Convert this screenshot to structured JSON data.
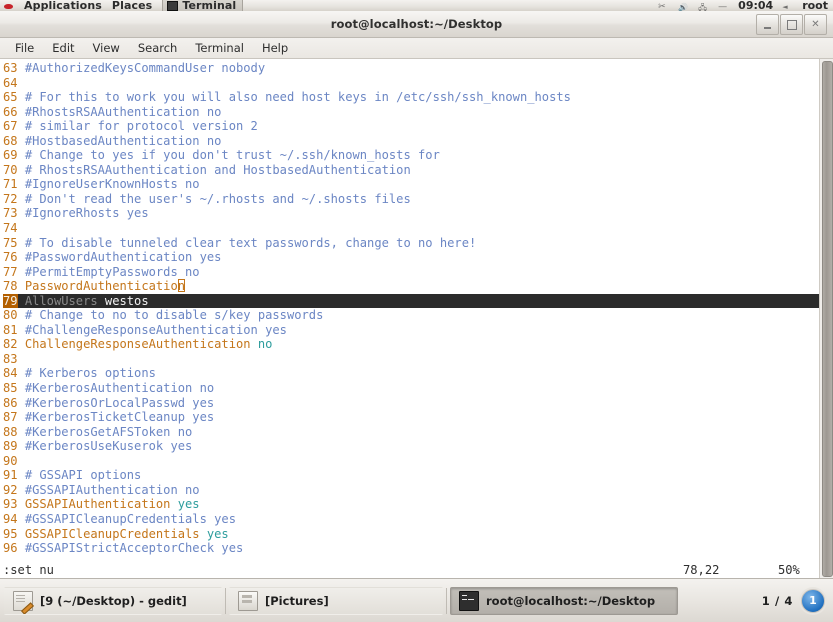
{
  "top_panel": {
    "menus": [
      "Applications",
      "Places"
    ],
    "window_button": "Terminal",
    "tray_icons": [
      "scissors-icon",
      "volume-icon",
      "network-icon",
      "power-icon"
    ],
    "clock": "09:04",
    "user": "root"
  },
  "window": {
    "title": "root@localhost:~/Desktop",
    "controls": {
      "minimize": "–",
      "maximize": "□",
      "close": "✕"
    },
    "menubar": [
      "File",
      "Edit",
      "View",
      "Search",
      "Terminal",
      "Help"
    ]
  },
  "terminal": {
    "lines": [
      {
        "n": "63",
        "segs": [
          {
            "t": "#AuthorizedKeysCommandUser nobody",
            "c": "cmt"
          }
        ]
      },
      {
        "n": "64",
        "segs": []
      },
      {
        "n": "65",
        "segs": [
          {
            "t": "# For this to work you will also need host keys in /etc/ssh/ssh_known_hosts",
            "c": "cmt"
          }
        ]
      },
      {
        "n": "66",
        "segs": [
          {
            "t": "#RhostsRSAAuthentication no",
            "c": "cmt"
          }
        ]
      },
      {
        "n": "67",
        "segs": [
          {
            "t": "# similar for protocol version 2",
            "c": "cmt"
          }
        ]
      },
      {
        "n": "68",
        "segs": [
          {
            "t": "#HostbasedAuthentication no",
            "c": "cmt"
          }
        ]
      },
      {
        "n": "69",
        "segs": [
          {
            "t": "# Change to yes if you don't trust ~/.ssh/known_hosts for",
            "c": "cmt"
          }
        ]
      },
      {
        "n": "70",
        "segs": [
          {
            "t": "# RhostsRSAAuthentication and HostbasedAuthentication",
            "c": "cmt"
          }
        ]
      },
      {
        "n": "71",
        "segs": [
          {
            "t": "#IgnoreUserKnownHosts no",
            "c": "cmt"
          }
        ]
      },
      {
        "n": "72",
        "segs": [
          {
            "t": "# Don't read the user's ~/.rhosts and ~/.shosts files",
            "c": "cmt"
          }
        ]
      },
      {
        "n": "73",
        "segs": [
          {
            "t": "#IgnoreRhosts yes",
            "c": "cmt"
          }
        ]
      },
      {
        "n": "74",
        "segs": []
      },
      {
        "n": "75",
        "segs": [
          {
            "t": "# To disable tunneled clear text passwords, change to no here!",
            "c": "cmt"
          }
        ]
      },
      {
        "n": "76",
        "segs": [
          {
            "t": "#PasswordAuthentication yes",
            "c": "cmt"
          }
        ]
      },
      {
        "n": "77",
        "segs": [
          {
            "t": "#PermitEmptyPasswords no",
            "c": "cmt"
          }
        ]
      },
      {
        "n": "78",
        "segs": [
          {
            "t": "PasswordAuthentication",
            "c": "kw",
            "cursor": true
          }
        ]
      },
      {
        "n": "79",
        "cur": true,
        "segs": [
          {
            "t": "AllowUsers",
            "c": "cur-kw"
          },
          {
            "t": " westos",
            "c": "cur-val"
          }
        ]
      },
      {
        "n": "80",
        "segs": [
          {
            "t": "# Change to no to disable s/key passwords",
            "c": "cmt"
          }
        ]
      },
      {
        "n": "81",
        "segs": [
          {
            "t": "#ChallengeResponseAuthentication yes",
            "c": "cmt"
          }
        ]
      },
      {
        "n": "82",
        "segs": [
          {
            "t": "ChallengeResponseAuthentication ",
            "c": "kw"
          },
          {
            "t": "no",
            "c": "val"
          }
        ]
      },
      {
        "n": "83",
        "segs": []
      },
      {
        "n": "84",
        "segs": [
          {
            "t": "# Kerberos options",
            "c": "cmt"
          }
        ]
      },
      {
        "n": "85",
        "segs": [
          {
            "t": "#KerberosAuthentication no",
            "c": "cmt"
          }
        ]
      },
      {
        "n": "86",
        "segs": [
          {
            "t": "#KerberosOrLocalPasswd yes",
            "c": "cmt"
          }
        ]
      },
      {
        "n": "87",
        "segs": [
          {
            "t": "#KerberosTicketCleanup yes",
            "c": "cmt"
          }
        ]
      },
      {
        "n": "88",
        "segs": [
          {
            "t": "#KerberosGetAFSToken no",
            "c": "cmt"
          }
        ]
      },
      {
        "n": "89",
        "segs": [
          {
            "t": "#KerberosUseKuserok yes",
            "c": "cmt"
          }
        ]
      },
      {
        "n": "90",
        "segs": []
      },
      {
        "n": "91",
        "segs": [
          {
            "t": "# GSSAPI options",
            "c": "cmt"
          }
        ]
      },
      {
        "n": "92",
        "segs": [
          {
            "t": "#GSSAPIAuthentication no",
            "c": "cmt"
          }
        ]
      },
      {
        "n": "93",
        "segs": [
          {
            "t": "GSSAPIAuthentication ",
            "c": "kw"
          },
          {
            "t": "yes",
            "c": "val"
          }
        ]
      },
      {
        "n": "94",
        "segs": [
          {
            "t": "#GSSAPICleanupCredentials yes",
            "c": "cmt"
          }
        ]
      },
      {
        "n": "95",
        "segs": [
          {
            "t": "GSSAPICleanupCredentials ",
            "c": "kw"
          },
          {
            "t": "yes",
            "c": "val"
          }
        ]
      },
      {
        "n": "96",
        "segs": [
          {
            "t": "#GSSAPIStrictAcceptorCheck yes",
            "c": "cmt"
          }
        ]
      }
    ],
    "status": {
      "command": ":set nu",
      "position": "78,22",
      "percent": "50%"
    }
  },
  "taskbar": {
    "items": [
      {
        "label": "[9 (~/Desktop) - gedit]",
        "icon": "gedit-icon",
        "active": false
      },
      {
        "label": "[Pictures]",
        "icon": "file-manager-icon",
        "active": false
      },
      {
        "label": "root@localhost:~/Desktop",
        "icon": "terminal-icon",
        "active": true
      }
    ],
    "pager": "1 / 4",
    "workspace_badge": "1"
  },
  "colors": {
    "comment": "#6b86c4",
    "keyword": "#c4761b",
    "value": "#2e9d9d",
    "cursor_line_bg": "#2b2b2b",
    "line_number": "#c4761b",
    "accent": "#1f6fc0"
  }
}
